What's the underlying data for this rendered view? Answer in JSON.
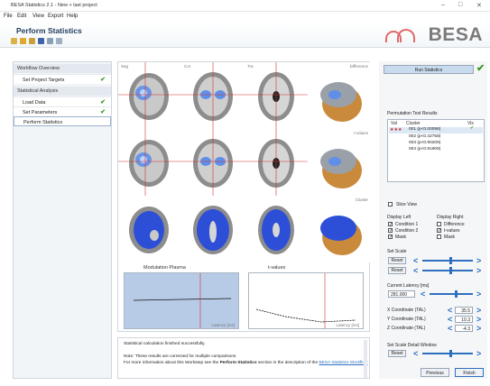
{
  "window": {
    "title": "BESA Statistics 2.1 - New + last project",
    "minimize": "–",
    "maximize": "□",
    "close": "✕"
  },
  "menu": [
    "File",
    "Edit",
    "View",
    "Export",
    "Help"
  ],
  "header": {
    "title": "Perform Statistics",
    "logo": "BESA"
  },
  "workflow": {
    "sections": [
      {
        "label": "Workflow Overview",
        "items": [
          {
            "label": "Set Project Targets",
            "done": true
          }
        ]
      },
      {
        "label": "Statistical Analysis",
        "items": [
          {
            "label": "Load Data",
            "done": true
          },
          {
            "label": "Set Parameters",
            "done": true
          },
          {
            "label": "Perform Statistics",
            "done": false
          }
        ]
      }
    ]
  },
  "views": {
    "row1": [
      "Sag",
      "Cor",
      "Tra",
      "Difference"
    ],
    "row2": "t-values",
    "row3": "Cluster"
  },
  "graphs": {
    "left": {
      "title": "Modulation Plasma",
      "xlabel": "Latency [ms]"
    },
    "right": {
      "title": "t-values",
      "xlabel": "Latency [ms]"
    }
  },
  "messages": {
    "status": "Statistical calculation finished successfully.",
    "note": "Note: These results are corrected for multiple comparisons",
    "more_prefix": "For more information about this Workstep see the",
    "more_bold": "Perform Statistics",
    "more_suffix": "section in the description of the",
    "more_link": "BESA Statistics Workflow"
  },
  "run": {
    "label": "Run Statistics"
  },
  "permutation": {
    "title": "Permutation Test Results",
    "columns": [
      "Val",
      "Cluster",
      "Vis"
    ],
    "rows": [
      {
        "stars": "★★★",
        "label": "001 (p<0.00098)"
      },
      {
        "stars": "",
        "label": "002 (p<0.42758)"
      },
      {
        "stars": "",
        "label": "003 (p<0.90209)"
      },
      {
        "stars": "",
        "label": "004 (p<0.91909)"
      }
    ]
  },
  "slice_view": "Slice View",
  "display_left": {
    "title": "Display Left",
    "options": [
      "Condition 1",
      "Condition 2",
      "Mask"
    ]
  },
  "display_right": {
    "title": "Display Right",
    "options": [
      "Difference",
      "t-values",
      "Mask"
    ]
  },
  "set_scale": {
    "title": "Set Scale",
    "reset": "Reset"
  },
  "latency": {
    "title": "Current Latency [ms]",
    "value": "281.000"
  },
  "coords": [
    {
      "label": "X Coordinate (TAL)",
      "value": "35.5"
    },
    {
      "label": "Y Coordinate (TAL)",
      "value": "10.3"
    },
    {
      "label": "Z Coordinate (TAL)",
      "value": "-4.3"
    }
  ],
  "scale_detail": {
    "title": "Set Scale Detail Window",
    "reset": "Reset"
  },
  "footer": {
    "previous": "Previous",
    "finish": "Finish"
  },
  "colors": {
    "accent": "#2f6fbf",
    "brain_blob": "#2d4fd8",
    "crosshair": "#d43030",
    "check": "#3a9a2a"
  }
}
